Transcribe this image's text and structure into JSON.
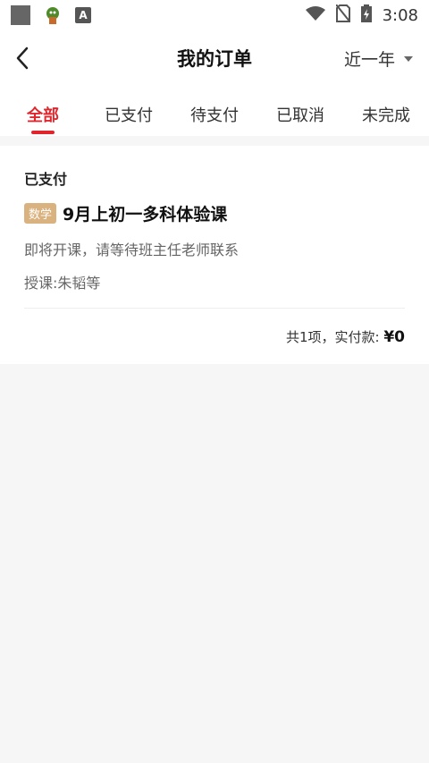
{
  "status_bar": {
    "time": "3:08",
    "icons": [
      "app-square-icon",
      "app-character-icon",
      "font-a-icon",
      "wifi-icon",
      "no-sim-icon",
      "battery-icon"
    ]
  },
  "header": {
    "title": "我的订单",
    "back_icon": "chevron-left-icon",
    "filter_label": "近一年"
  },
  "tabs": [
    {
      "label": "全部",
      "active": true
    },
    {
      "label": "已支付",
      "active": false
    },
    {
      "label": "待支付",
      "active": false
    },
    {
      "label": "已取消",
      "active": false
    },
    {
      "label": "未完成",
      "active": false
    }
  ],
  "order": {
    "status": "已支付",
    "subject_tag": "数学",
    "course_title": "9月上初一多科体验课",
    "note": "即将开课，请等待班主任老师联系",
    "teacher": "授课:朱韬等",
    "total_prefix": "共1项，实付款: ",
    "total_amount": "¥0"
  },
  "colors": {
    "accent": "#e0262c",
    "tag_bg": "#d9b27f",
    "page_bg": "#f6f6f6"
  }
}
